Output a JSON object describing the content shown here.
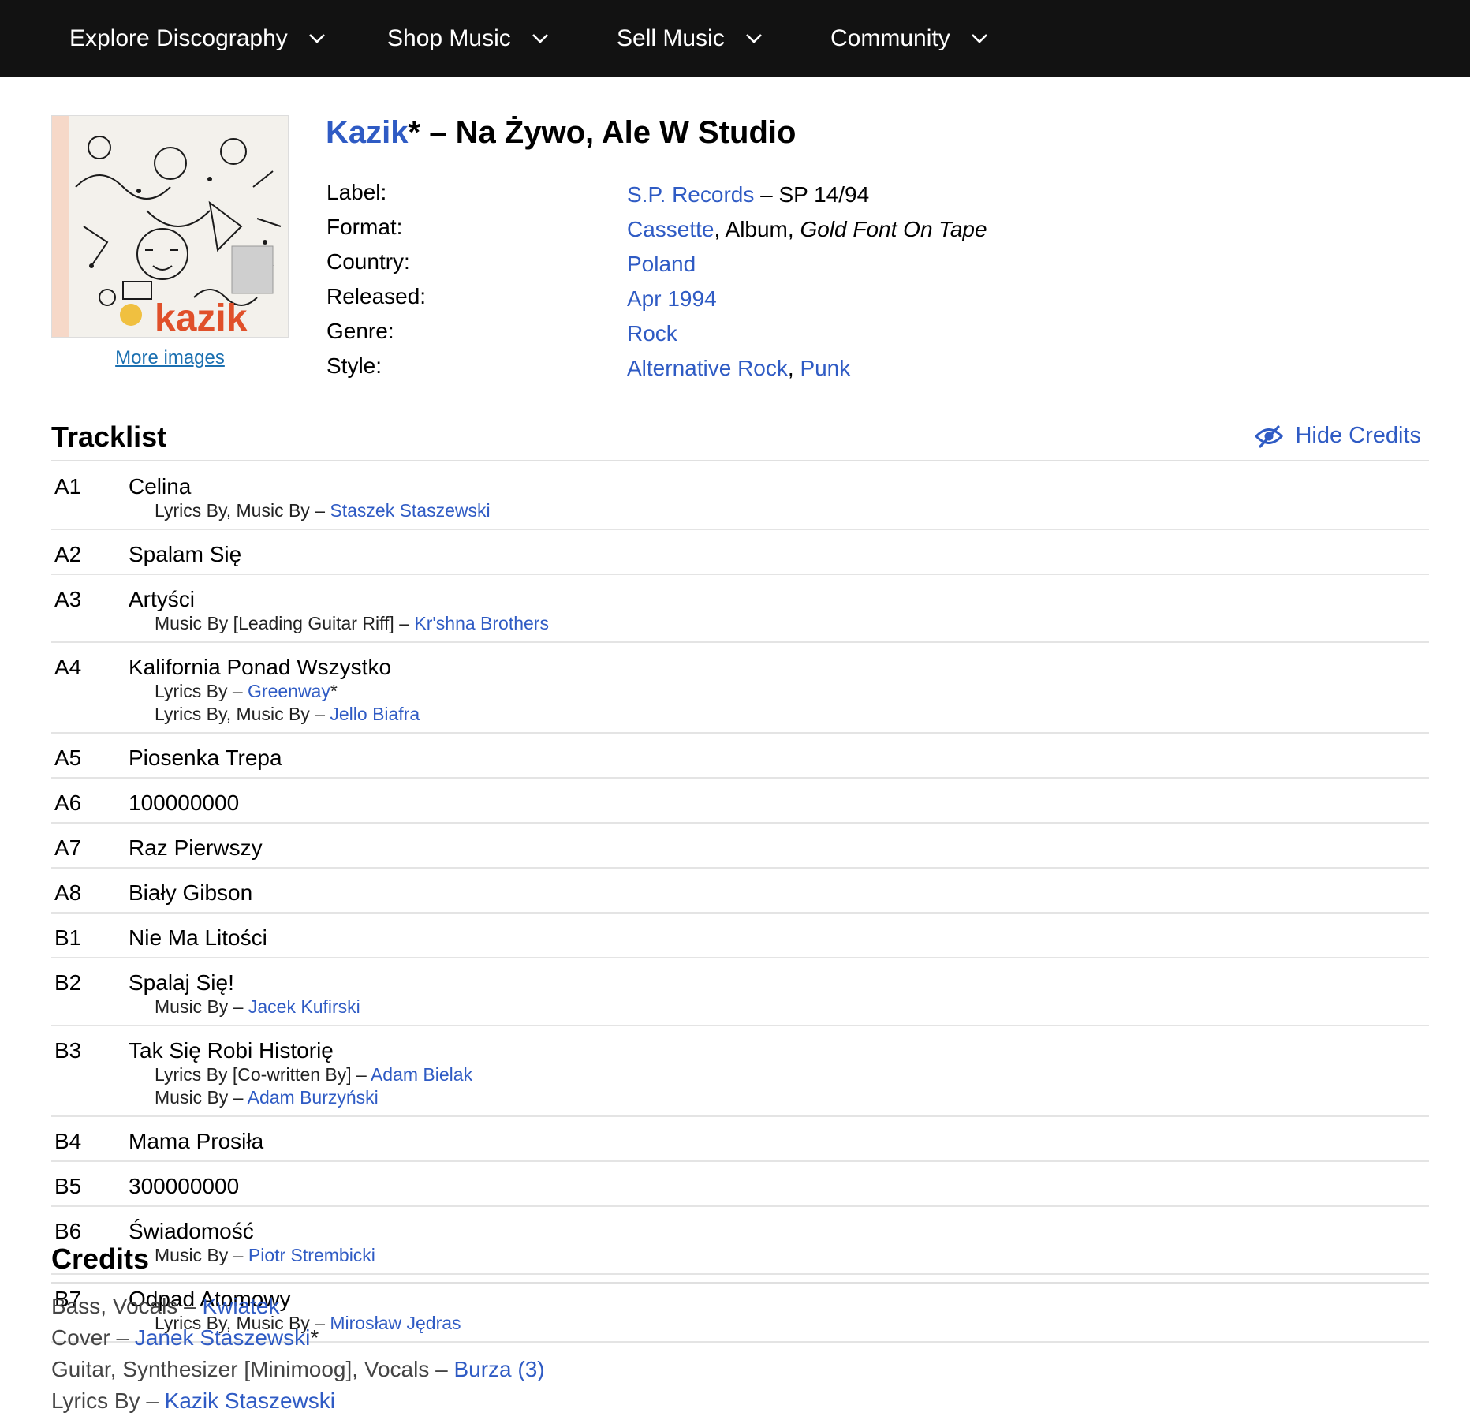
{
  "nav": {
    "items": [
      {
        "label": "Explore Discography"
      },
      {
        "label": "Shop Music"
      },
      {
        "label": "Sell Music"
      },
      {
        "label": "Community"
      }
    ]
  },
  "release": {
    "artist": "Kazik",
    "artist_suffix": "*",
    "title_separator": " – ",
    "title": "Na Żywo, Ale W Studio",
    "more_images": "More images",
    "cover_text": "kazik",
    "profile": [
      {
        "label": "Label:",
        "parts": [
          {
            "text": "S.P. Records",
            "link": true
          },
          {
            "text": " – SP 14/94",
            "link": false
          }
        ]
      },
      {
        "label": "Format:",
        "parts": [
          {
            "text": "Cassette",
            "link": true
          },
          {
            "text": ", Album, ",
            "link": false
          },
          {
            "text": "Gold Font On Tape",
            "link": false,
            "italic": true
          }
        ]
      },
      {
        "label": "Country:",
        "parts": [
          {
            "text": "Poland",
            "link": true
          }
        ]
      },
      {
        "label": "Released:",
        "parts": [
          {
            "text": "Apr 1994",
            "link": true
          }
        ]
      },
      {
        "label": "Genre:",
        "parts": [
          {
            "text": "Rock",
            "link": true
          }
        ]
      },
      {
        "label": "Style:",
        "parts": [
          {
            "text": "Alternative Rock",
            "link": true
          },
          {
            "text": ", ",
            "link": false
          },
          {
            "text": "Punk",
            "link": true
          }
        ]
      }
    ]
  },
  "tracklist": {
    "heading": "Tracklist",
    "hide_credits": "Hide Credits",
    "tracks": [
      {
        "pos": "A1",
        "title": "Celina",
        "credits": [
          {
            "role": "Lyrics By, Music By – ",
            "name": "Staszek Staszewski",
            "suffix": ""
          }
        ]
      },
      {
        "pos": "A2",
        "title": "Spalam Się",
        "credits": []
      },
      {
        "pos": "A3",
        "title": "Artyści",
        "credits": [
          {
            "role": "Music By [Leading Guitar Riff] – ",
            "name": "Kr'shna Brothers",
            "suffix": ""
          }
        ]
      },
      {
        "pos": "A4",
        "title": "Kalifornia Ponad Wszystko",
        "credits": [
          {
            "role": "Lyrics By – ",
            "name": "Greenway",
            "suffix": "*"
          },
          {
            "role": "Lyrics By, Music By – ",
            "name": "Jello Biafra",
            "suffix": ""
          }
        ]
      },
      {
        "pos": "A5",
        "title": "Piosenka Trepa",
        "credits": []
      },
      {
        "pos": "A6",
        "title": "100000000",
        "credits": []
      },
      {
        "pos": "A7",
        "title": "Raz Pierwszy",
        "credits": []
      },
      {
        "pos": "A8",
        "title": "Biały Gibson",
        "credits": []
      },
      {
        "pos": "B1",
        "title": "Nie Ma Litości",
        "credits": []
      },
      {
        "pos": "B2",
        "title": "Spalaj Się!",
        "credits": [
          {
            "role": "Music By – ",
            "name": "Jacek Kufirski",
            "suffix": ""
          }
        ]
      },
      {
        "pos": "B3",
        "title": "Tak Się Robi Historię",
        "credits": [
          {
            "role": "Lyrics By [Co-written By] – ",
            "name": "Adam Bielak",
            "suffix": ""
          },
          {
            "role": "Music By – ",
            "name": "Adam Burzyński",
            "suffix": ""
          }
        ]
      },
      {
        "pos": "B4",
        "title": "Mama Prosiła",
        "credits": []
      },
      {
        "pos": "B5",
        "title": "300000000",
        "credits": []
      },
      {
        "pos": "B6",
        "title": "Świadomość",
        "credits": [
          {
            "role": "Music By – ",
            "name": "Piotr Strembicki",
            "suffix": ""
          }
        ]
      },
      {
        "pos": "B7",
        "title": "Odpad Atomowy",
        "credits": [
          {
            "role": "Lyrics By, Music By – ",
            "name": "Mirosław Jędras",
            "suffix": ""
          }
        ]
      }
    ]
  },
  "credits": {
    "heading": "Credits",
    "rows": [
      {
        "role": "Bass, Vocals – ",
        "name": "Kwiatek",
        "suffix": ""
      },
      {
        "role": "Cover – ",
        "name": "Janek Staszewski",
        "suffix": "*"
      },
      {
        "role": "Guitar, Synthesizer [Minimoog], Vocals – ",
        "name": "Burza (3)",
        "suffix": ""
      },
      {
        "role": "Lyrics By – ",
        "name": "Kazik Staszewski",
        "suffix": ""
      }
    ]
  },
  "colors": {
    "nav_bg": "#121212",
    "link": "#2f5bc4",
    "accent_cover": "#e0502a"
  }
}
